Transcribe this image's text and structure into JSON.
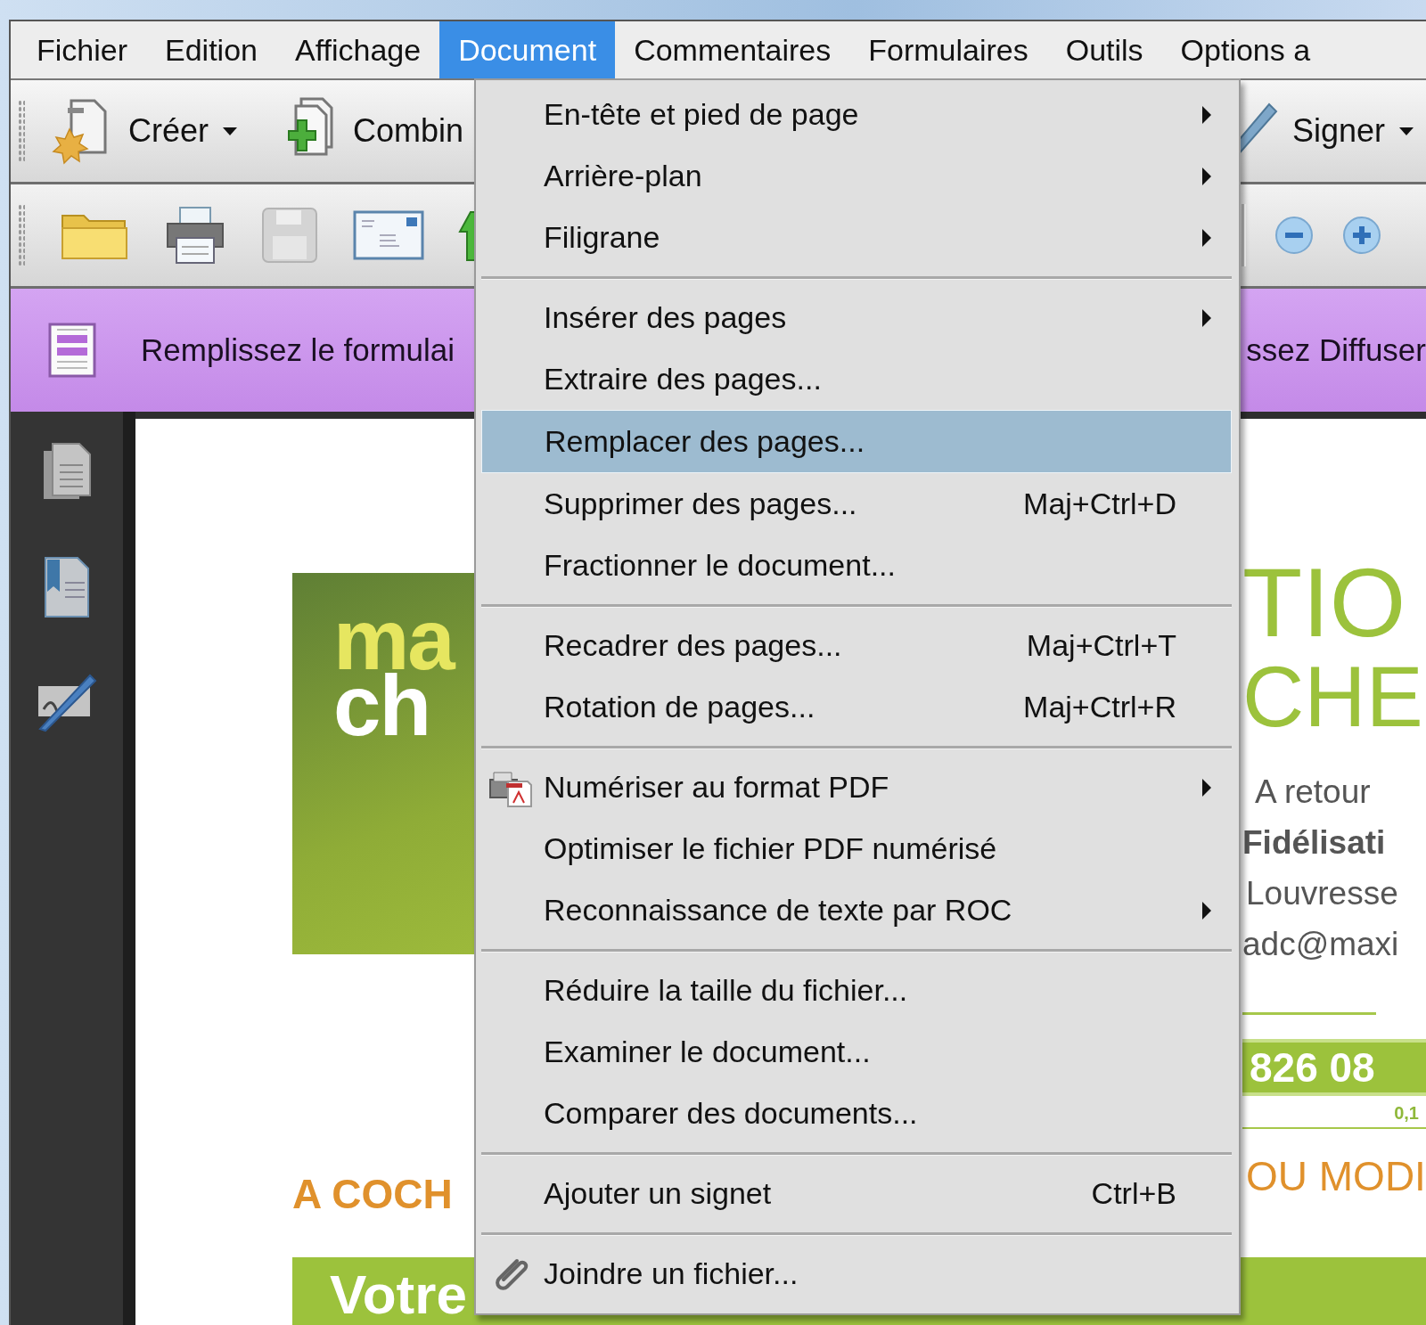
{
  "menu_bar": [
    {
      "label": "Fichier",
      "selected": false
    },
    {
      "label": "Edition",
      "selected": false
    },
    {
      "label": "Affichage",
      "selected": false
    },
    {
      "label": "Document",
      "selected": true
    },
    {
      "label": "Commentaires",
      "selected": false
    },
    {
      "label": "Formulaires",
      "selected": false
    },
    {
      "label": "Outils",
      "selected": false
    },
    {
      "label": "Options a",
      "selected": false
    }
  ],
  "toolbar": [
    {
      "kind": "create",
      "label": "Créer",
      "dropdown": true
    },
    {
      "kind": "combine",
      "label": "Combin"
    },
    {
      "kind": "sign",
      "label": "Signer",
      "dropdown": true
    }
  ],
  "notification": {
    "text_left": "Remplissez le formulai",
    "text_right": "ssez Diffuser"
  },
  "document": {
    "logo_lines": [
      "ma",
      "ch"
    ],
    "left_heading": "A COCH",
    "banner": "Votre",
    "title_lines": [
      "TIO",
      "CHE"
    ],
    "address_lines": [
      {
        "text": "A retour",
        "bold": false
      },
      {
        "text": "Fidélisati",
        "bold": true
      },
      {
        "text": "Louvresse",
        "bold": false
      },
      {
        "text": "adc@maxi",
        "bold": false
      }
    ],
    "phone": "826 08",
    "price_note": "0,1",
    "right_heading": "OU MODI"
  },
  "menu": {
    "groups": [
      {
        "items": [
          {
            "label": "En-tête et pied de page",
            "kind": "plain",
            "submenu": true,
            "selected": false
          },
          {
            "label": "Arrière-plan",
            "kind": "plain",
            "submenu": true,
            "selected": false
          },
          {
            "label": "Filigrane",
            "kind": "plain",
            "submenu": true,
            "selected": false
          }
        ]
      },
      {
        "items": [
          {
            "label": "Insérer des pages",
            "kind": "plain",
            "submenu": true,
            "selected": false
          },
          {
            "label": "Extraire des pages...",
            "kind": "plain",
            "submenu": false,
            "selected": false
          },
          {
            "label": "Remplacer des pages...",
            "kind": "plain",
            "submenu": false,
            "selected": true
          },
          {
            "label": "Supprimer des pages...",
            "kind": "plain",
            "shortcut": "Maj+Ctrl+D",
            "submenu": false,
            "selected": false
          },
          {
            "label": "Fractionner le document...",
            "kind": "plain",
            "submenu": false,
            "selected": false
          }
        ]
      },
      {
        "items": [
          {
            "label": "Recadrer des pages...",
            "kind": "plain",
            "shortcut": "Maj+Ctrl+T",
            "submenu": false,
            "selected": false
          },
          {
            "label": "Rotation de pages...",
            "kind": "plain",
            "shortcut": "Maj+Ctrl+R",
            "submenu": false,
            "selected": false
          }
        ]
      },
      {
        "items": [
          {
            "label": "Numériser au format PDF",
            "kind": "scan",
            "submenu": true,
            "selected": false
          },
          {
            "label": "Optimiser le fichier PDF numérisé",
            "kind": "plain",
            "submenu": false,
            "selected": false
          },
          {
            "label": "Reconnaissance de texte par ROC",
            "kind": "plain",
            "submenu": true,
            "selected": false
          }
        ]
      },
      {
        "items": [
          {
            "label": "Réduire la taille du fichier...",
            "kind": "plain",
            "submenu": false,
            "selected": false
          },
          {
            "label": "Examiner le document...",
            "kind": "plain",
            "submenu": false,
            "selected": false
          },
          {
            "label": "Comparer des documents...",
            "kind": "plain",
            "submenu": false,
            "selected": false
          }
        ]
      },
      {
        "items": [
          {
            "label": "Ajouter un signet",
            "kind": "plain",
            "shortcut": "Ctrl+B",
            "submenu": false,
            "selected": false
          }
        ]
      },
      {
        "items": [
          {
            "label": "Joindre un fichier...",
            "kind": "attach",
            "submenu": false,
            "selected": false
          }
        ]
      }
    ]
  }
}
